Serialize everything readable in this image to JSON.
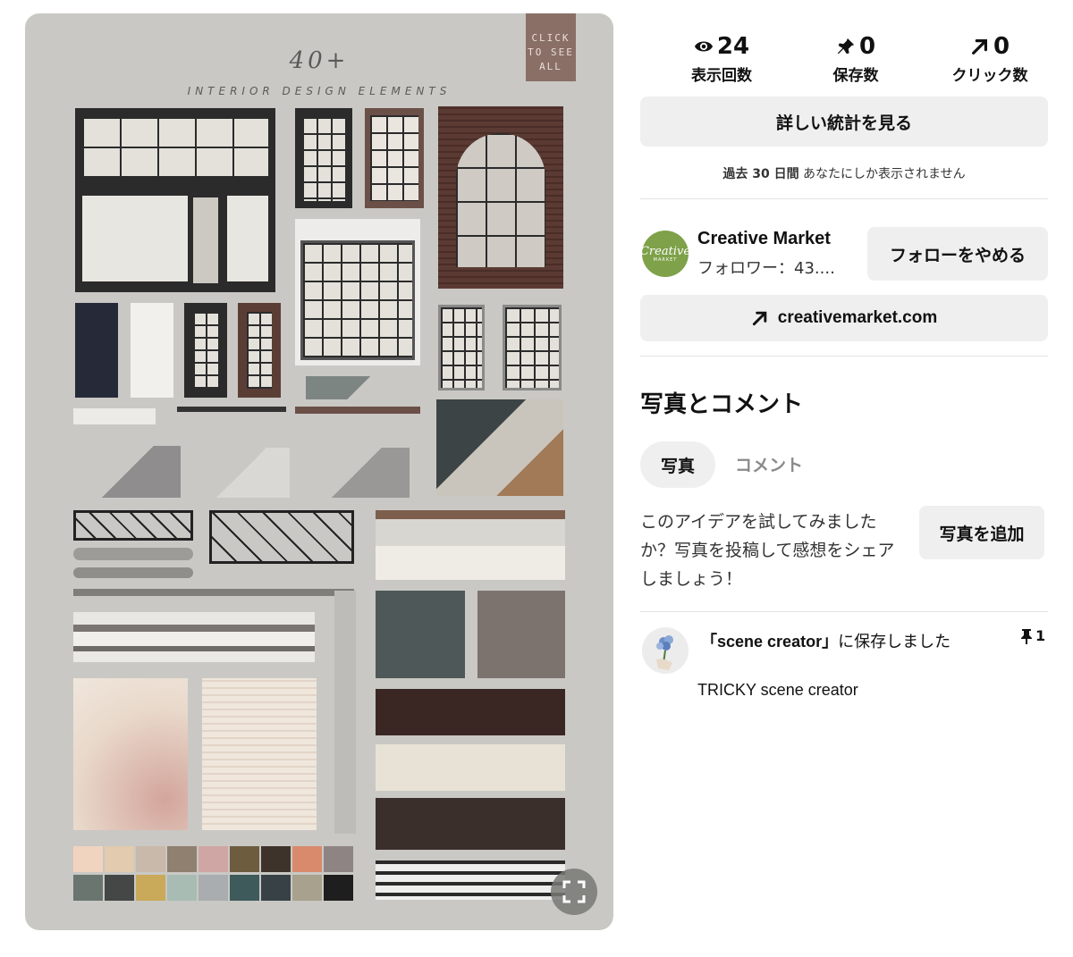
{
  "image": {
    "headline_number": "40+",
    "headline_sub": "INTERIOR DESIGN ELEMENTS",
    "tag_lines": [
      "CLICK",
      "TO SEE",
      "ALL"
    ],
    "expand_icon": "expand-icon"
  },
  "stats": [
    {
      "icon": "eye-icon",
      "value": "24",
      "label": "表示回数"
    },
    {
      "icon": "pin-icon",
      "value": "0",
      "label": "保存数"
    },
    {
      "icon": "arrow-up-right-icon",
      "value": "0",
      "label": "クリック数"
    }
  ],
  "detail_button": "詳しい統計を見る",
  "period_note": {
    "bold": "過去 30 日間",
    "text": "あなたにしか表示されません"
  },
  "profile": {
    "avatar_text": "Creative",
    "avatar_sub": "MARKET",
    "name": "Creative Market",
    "followers": "フォロワー：43....",
    "follow_button": "フォローをやめる"
  },
  "website_button": "creativemarket.com",
  "photos_section": {
    "title": "写真とコメント",
    "tabs": [
      "写真",
      "コメント"
    ],
    "tip": "このアイデアを試してみましたか？写真を投稿して感想をシェアしましょう！",
    "add_button": "写真を追加"
  },
  "board": {
    "saved_quote": "「scene creator」",
    "saved_suffix": "に保存しました",
    "board_owner": "TRICKY scene creator",
    "pin_count": "1"
  },
  "colors": {
    "image_bg": "#c9c8c4",
    "button_bg": "#efefef",
    "avatar_green": "#7ea14a",
    "tag_brown": "#8a6f66"
  }
}
